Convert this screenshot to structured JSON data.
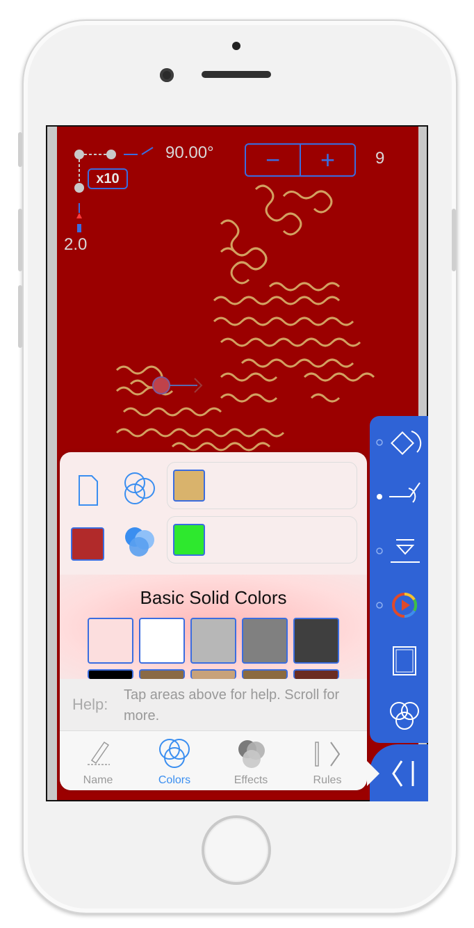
{
  "controls": {
    "angle": "90.00°",
    "multiplier": "x10",
    "length": "2.0",
    "minus": "−",
    "plus": "+",
    "iterations": "9"
  },
  "panel": {
    "section_title": "Basic Solid Colors",
    "help_label": "Help:",
    "help_text": "Tap areas above for help. Scroll for more.",
    "line_swatch_color": "#d9b36c",
    "fill_swatch_color": "#2ee82e",
    "background_swatch_color": "#b12a2a",
    "palette": [
      "#fcdede",
      "#ffffff",
      "#b7b7b7",
      "#808080",
      "#3f3f3f"
    ],
    "palette_partial": [
      "#000000",
      "#8a6a45",
      "#c8a27a",
      "#8b6a3f",
      "#6b2b22"
    ]
  },
  "tabs": [
    {
      "label": "Name",
      "icon": "pencil-icon"
    },
    {
      "label": "Colors",
      "icon": "overlapping-circles-icon"
    },
    {
      "label": "Effects",
      "icon": "gradient-circles-icon"
    },
    {
      "label": "Rules",
      "icon": "brackets-icon"
    }
  ],
  "colors": {
    "canvas": "#9b0000",
    "accent": "#3a6de0",
    "sidebar": "#2f63d6",
    "active_tab": "#3a8ef0",
    "fractal": "#d9b36c"
  }
}
